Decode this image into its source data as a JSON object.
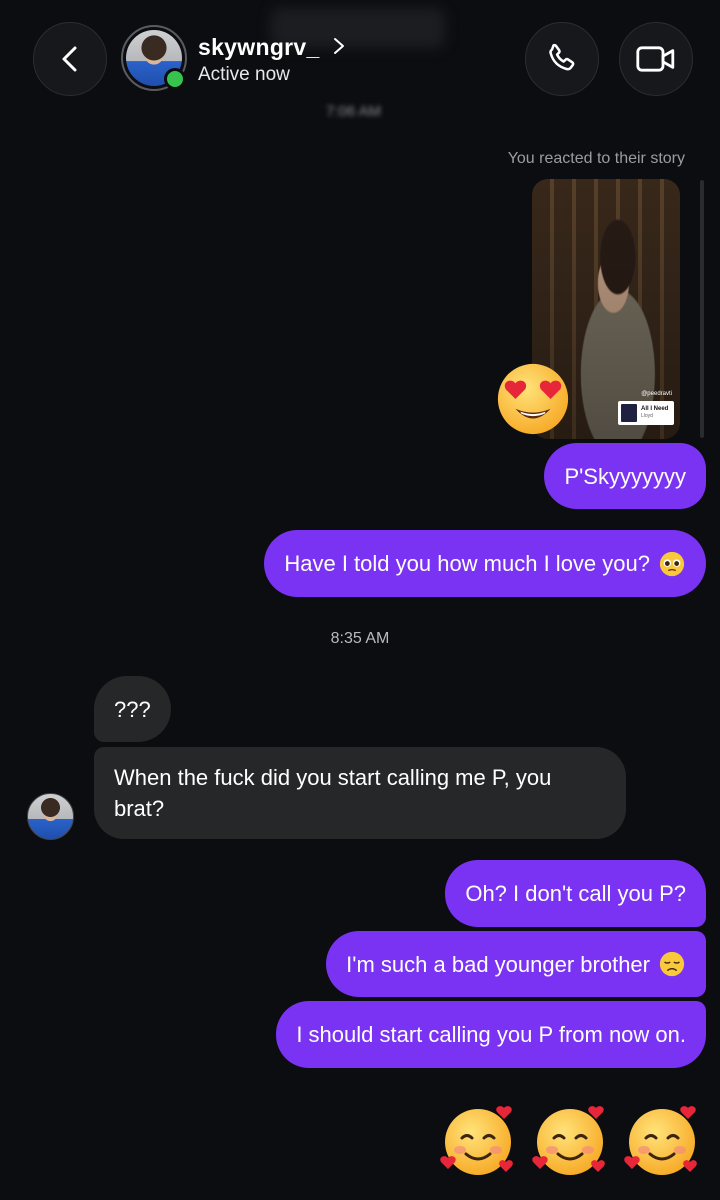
{
  "header": {
    "username": "skywngrv_",
    "status": "Active now",
    "blurred_time": "7:06 AM"
  },
  "story": {
    "label": "You reacted to their story",
    "handle": "@peedravti",
    "music_title": "All I Need",
    "music_artist": "Lloyd",
    "reaction_icon": "heart-eyes-emoji"
  },
  "messages": {
    "out1": "P'Skyyyyyyy",
    "out2": "Have I told you how much I love you?",
    "time2": "8:35 AM",
    "in1": "???",
    "in2": "When the fuck did you start calling me P, you brat?",
    "out3": "Oh? I don't call you P?",
    "out4": "I'm such a bad younger brother",
    "out5": "I should start calling you P from now on."
  },
  "colors": {
    "background": "#0c0d10",
    "outgoing_bubble": "#7a33f2",
    "incoming_bubble": "#262729",
    "online": "#37c44e"
  }
}
